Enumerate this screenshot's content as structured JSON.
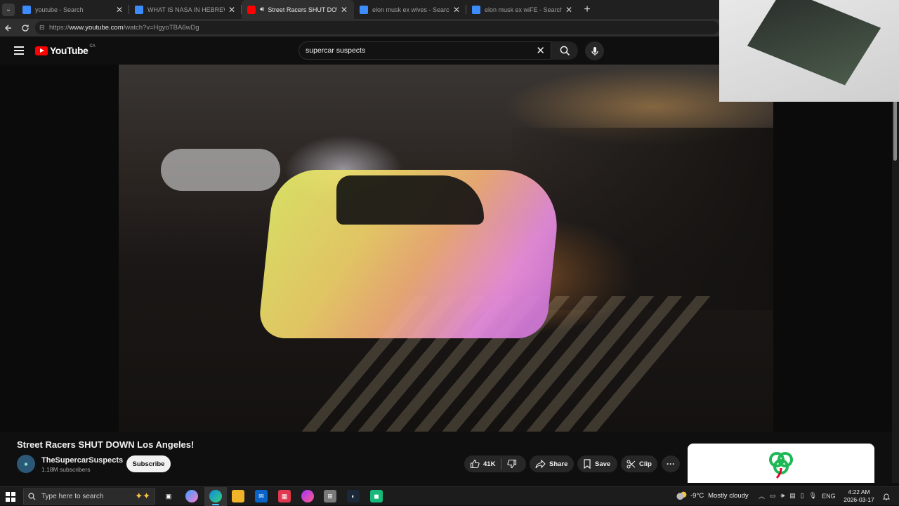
{
  "browser": {
    "tabs": [
      {
        "title": "youtube - Search",
        "favicon_color": "#3c8cff",
        "active": false
      },
      {
        "title": "WHAT IS NASA IN HEBREW - Search",
        "favicon_color": "#3c8cff",
        "active": false
      },
      {
        "title": "Street Racers SHUT DOWN Los Angeles!",
        "favicon_color": "#ff0000",
        "active": true,
        "audio": true
      },
      {
        "title": "elon musk ex wives - Search",
        "favicon_color": "#3c8cff",
        "active": false
      },
      {
        "title": "elon musk ex wiFE - Search Images",
        "favicon_color": "#3c8cff",
        "active": false
      }
    ],
    "url_prefix": "https://",
    "url_host": "www.youtube.com",
    "url_path": "/watch?v=HgyoTBA6wDg"
  },
  "youtube": {
    "logo_text": "YouTube",
    "country_code": "CA",
    "search_value": "supercar suspects"
  },
  "video": {
    "title": "Street Racers SHUT DOWN Los Angeles!",
    "channel_name": "TheSupercarSuspects",
    "subscribers": "1.18M subscribers",
    "subscribe_label": "Subscribe",
    "like_count": "41K",
    "share_label": "Share",
    "save_label": "Save",
    "clip_label": "Clip",
    "more_label": "···"
  },
  "taskbar": {
    "search_placeholder": "Type here to search",
    "weather_temp": "-9°C",
    "weather_text": "Mostly cloudy",
    "language": "ENG",
    "time": "4:22 AM",
    "date": "2026-03-17"
  },
  "colors": {
    "youtube_red": "#ff0000",
    "accent_blue": "#4cc2ff",
    "background": "#0f0f0f"
  }
}
